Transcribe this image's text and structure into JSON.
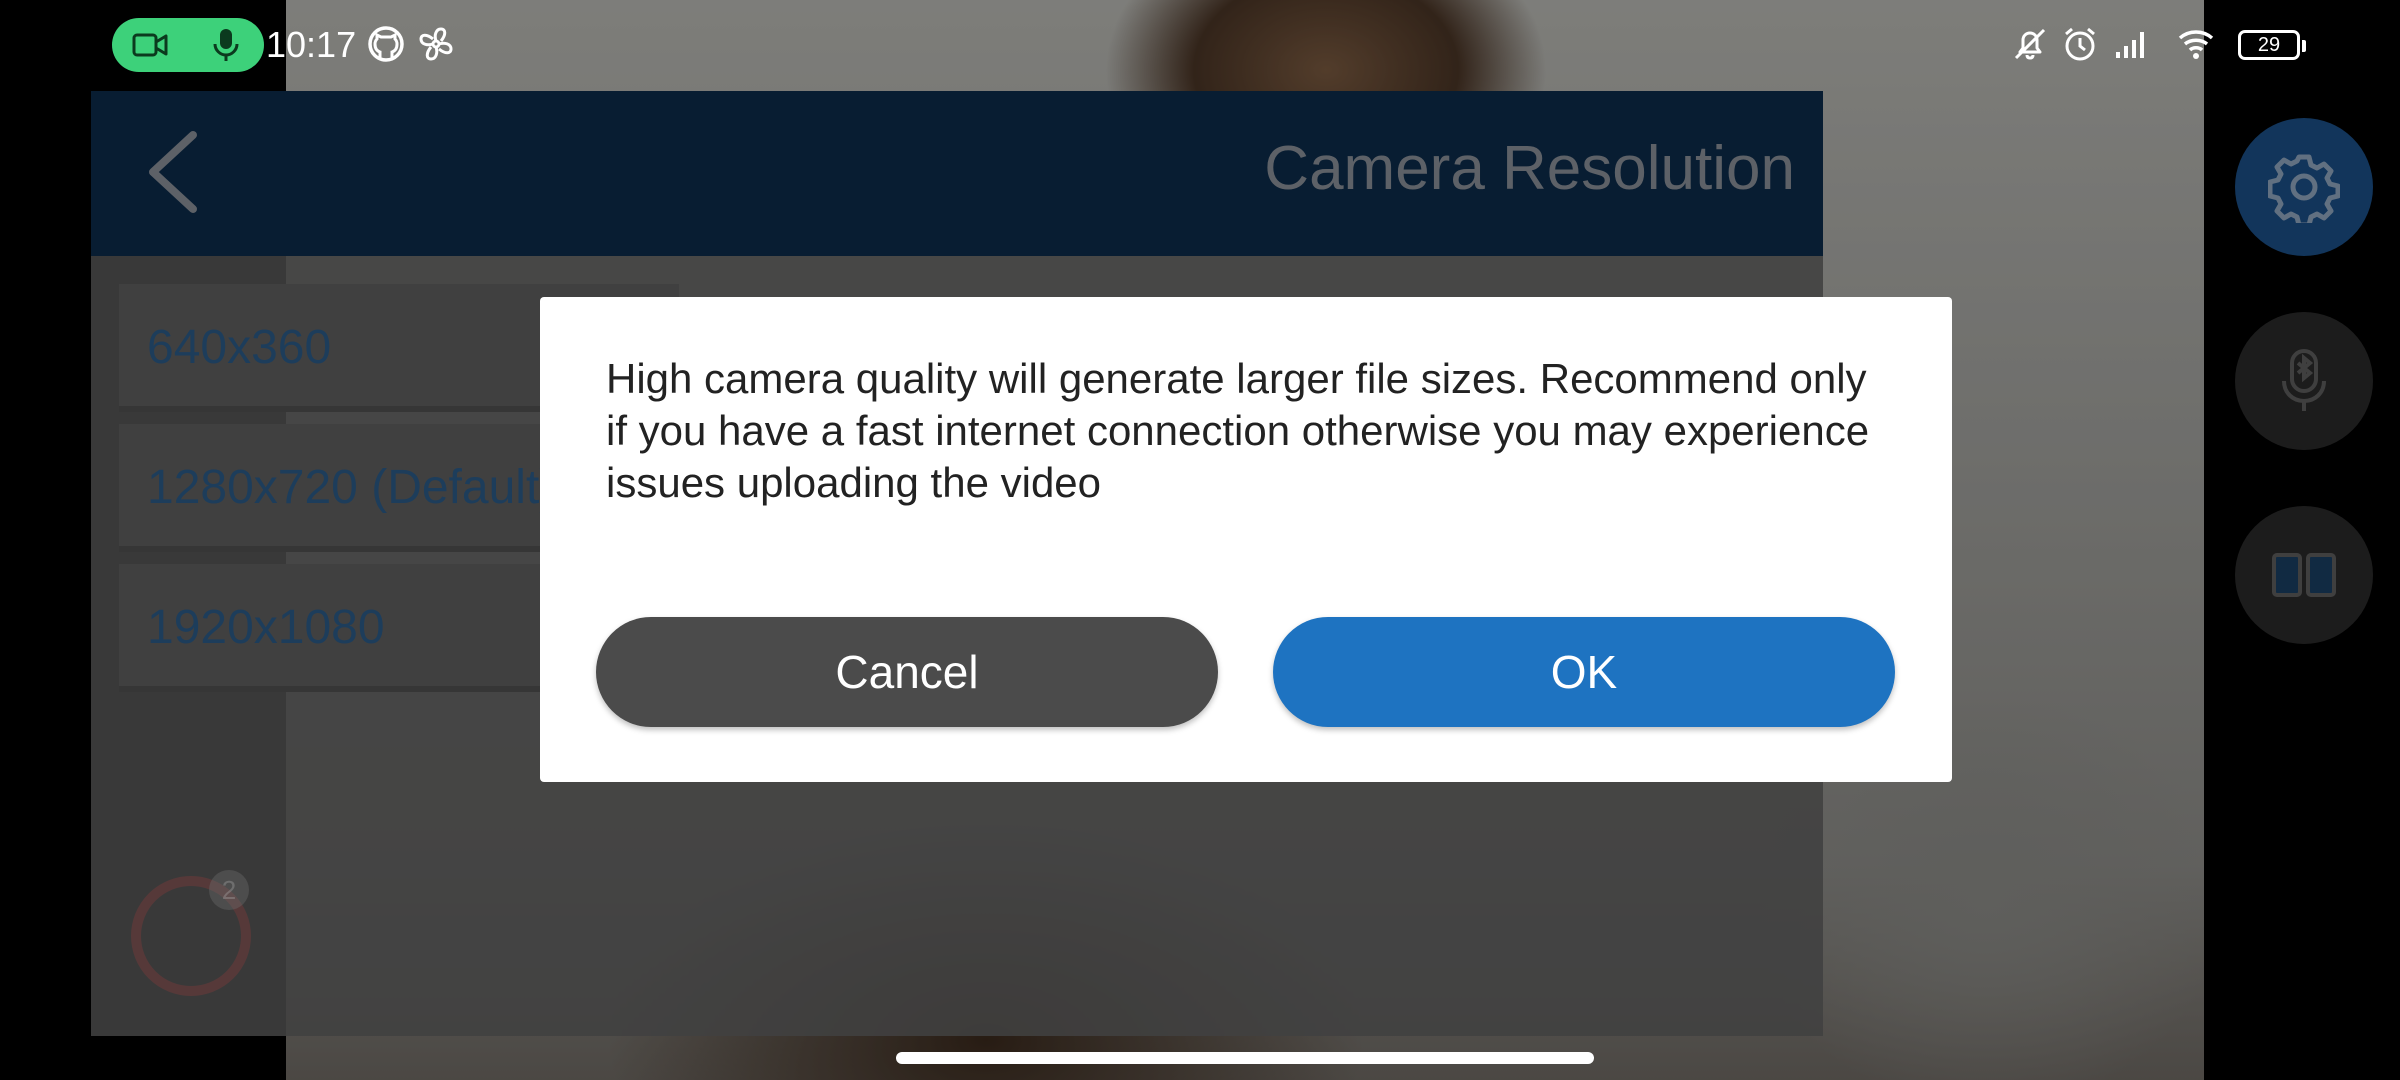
{
  "status_bar": {
    "time": "10:17",
    "battery": "29",
    "icons": [
      "video-icon",
      "mic-icon",
      "github-icon",
      "fan-icon",
      "bell-off-icon",
      "alarm-icon",
      "signal-icon",
      "wifi-icon",
      "battery-icon"
    ]
  },
  "panel": {
    "title": "Camera Resolution",
    "resolutions": [
      "640x360",
      "1280x720 (Default)",
      "1920x1080"
    ],
    "record_badge": "2"
  },
  "dialog": {
    "message": "High camera quality will generate larger file sizes. Recommend only if you have a fast internet connection otherwise you may experience issues uploading the video",
    "cancel_label": "Cancel",
    "ok_label": "OK"
  },
  "colors": {
    "header_bg": "#0d2c4a",
    "ok_button": "#1e73c1",
    "cancel_button": "#4b4b4b",
    "recording_pill": "#3dd17a",
    "settings_button": "#1b4f86"
  }
}
